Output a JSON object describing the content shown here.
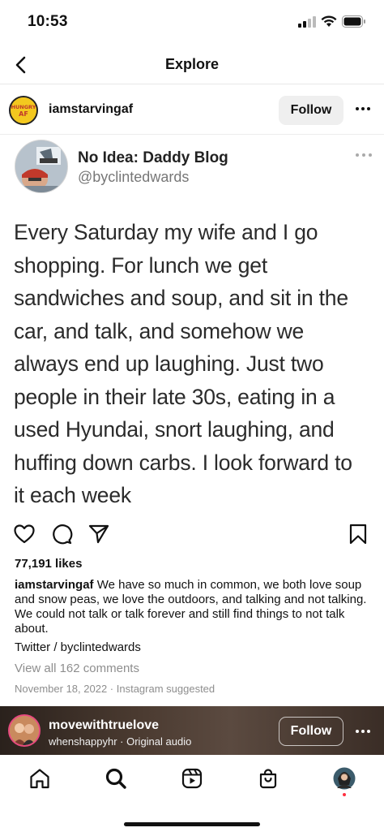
{
  "status_bar": {
    "time": "10:53"
  },
  "nav": {
    "title": "Explore"
  },
  "post": {
    "username": "iamstarvingaf",
    "avatar_text": "HUNGRY AF",
    "follow_label": "Follow",
    "tweet": {
      "name": "No Idea: Daddy Blog",
      "handle": "@byclintedwards",
      "text": "Every Saturday my wife and I go shopping. For lunch we get sandwiches and soup, and sit in the car, and talk, and somehow we always end up laughing. Just two people in their late 30s, eating in a used Hyundai, snort laughing, and huffing down carbs. I look forward to it each week",
      "text_lines": [
        "Every Saturday my wife and I go",
        "shopping. For lunch we get",
        "sandwiches and soup, and sit in the",
        "car, and talk, and somehow we",
        "always end up laughing. Just two",
        "people in their late 30s, eating in a",
        "used Hyundai, snort laughing, and",
        "huffing down carbs. I look forward to",
        "it each week"
      ]
    },
    "likes": "77,191 likes",
    "caption_user": "iamstarvingaf",
    "caption_text": " We have so much in common, we both love soup and snow peas, we love the outdoors, and talking and not talking. We could not talk or talk forever and still find things to not talk about.",
    "caption_credit": "Twitter / byclintedwards",
    "view_comments": "View all 162 comments",
    "date": "November 18, 2022 · Instagram suggested"
  },
  "reel": {
    "username": "movewithtruelove",
    "subtitle": "whenshappyhr · Original audio",
    "follow_label": "Follow"
  },
  "tabs": [
    {
      "name": "home",
      "icon": "home-icon"
    },
    {
      "name": "search",
      "icon": "search-icon"
    },
    {
      "name": "reels",
      "icon": "reels-icon"
    },
    {
      "name": "shop",
      "icon": "shop-icon"
    },
    {
      "name": "profile",
      "icon": "profile-avatar"
    }
  ],
  "colors": {
    "text": "#111111",
    "secondary": "#8e8e8e",
    "follow_bg": "#efefef",
    "notification_dot": "#ff3040"
  }
}
